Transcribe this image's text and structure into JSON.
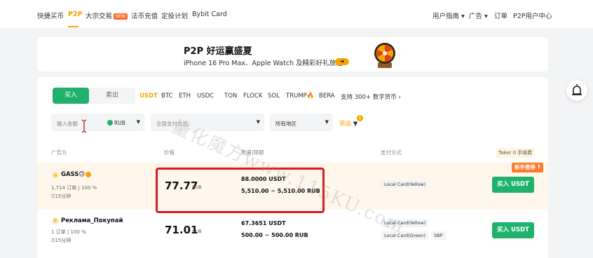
{
  "nav": {
    "left": [
      "快捷买币",
      "P2P",
      "大宗交易",
      "法币充值",
      "定投计划",
      "Bybit Card"
    ],
    "new_badge": "NEW",
    "right": [
      "用户指南 ▾",
      "广告 ▾",
      "订单",
      "P2P用户中心"
    ]
  },
  "banner": {
    "title": "P2P 好运赢盛夏",
    "subtitle": "iPhone 16 Pro Max、Apple Watch 及精彩好礼放送！",
    "arrow": "➜"
  },
  "trade": {
    "buy": "买入",
    "sell": "卖出",
    "coins": [
      "USDT",
      "BTC",
      "ETH",
      "USDC",
      "TON",
      "FLOCK",
      "SOL",
      "TRUMP",
      "BERA",
      "支持 300+ 数字货币"
    ],
    "coin_suffix": "🔥",
    "more_arrow": "›"
  },
  "filters": {
    "amount_placeholder": "输入金额",
    "currency": "RUB",
    "payment_placeholder": "全部支付方式",
    "region": "所有地区",
    "filter_label": "筛选",
    "filter_count": "1"
  },
  "table": {
    "headers": [
      "广告方",
      "价格",
      "数量|限额",
      "支付方式"
    ],
    "taker_fee": "Taker 0 手续费",
    "rows": [
      {
        "avatar": "G",
        "name": "GASS🙃",
        "stats": "1,714 订单  |  100 %",
        "time": "⏱15分钟",
        "price": "77.77",
        "unit": "RUB",
        "quantity": "88.0000 USDT",
        "limit": "5,510.00 ~ 5,510.00 RUB",
        "payments": [
          "Local Card(Yellow)"
        ],
        "action": "买入 USDT",
        "badge": "新手推荐 ?"
      },
      {
        "avatar": "P",
        "name": "Реклама_Покупай",
        "stats": "1 订单  |  100 %",
        "time": "⏱15分钟",
        "price": "71.01",
        "unit": "RUB",
        "quantity": "67.3651 USDT",
        "limit": "500.00 ~ 500.00 RUB",
        "payments": [
          "Local Card(Yellow)",
          "Local Card(Green)",
          "SBP"
        ],
        "action": "买入 USDT"
      }
    ]
  },
  "watermark": "量化魔方www.115KU.com",
  "colors": {
    "accent": "#f7a600",
    "buy": "#20b26c",
    "highlight": "#e0191e"
  }
}
